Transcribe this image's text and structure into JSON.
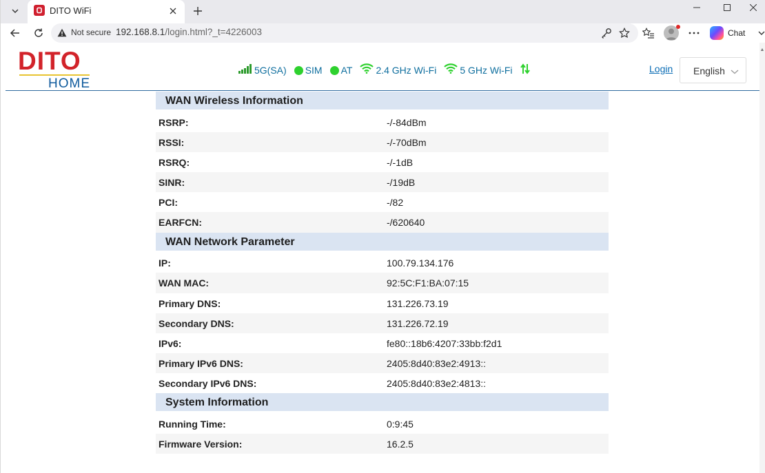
{
  "browser": {
    "tab_title": "DITO WiFi",
    "security_label": "Not secure",
    "url_host": "192.168.8.1",
    "url_path": "/login.html?_t=4226003",
    "chat_label": "Chat"
  },
  "header": {
    "logo_text": "DITO",
    "logo_subtext": "HOME",
    "status": {
      "network": "5G(SA)",
      "sim": "SIM",
      "at": "AT",
      "wifi_24": "2.4 GHz Wi-Fi",
      "wifi_5": "5 GHz Wi-Fi"
    },
    "login_label": "Login",
    "language": "English",
    "colors": {
      "status_dot": "#2ed12e",
      "wifi_icon": "#2ed12e",
      "link": "#0b6db5",
      "brand_red": "#d2232a",
      "brand_blue": "#0e5a9c"
    }
  },
  "sections": [
    {
      "title": "WAN Wireless Information",
      "rows": [
        {
          "label": "RSRP:",
          "value": "-/-84dBm"
        },
        {
          "label": "RSSI:",
          "value": "-/-70dBm"
        },
        {
          "label": "RSRQ:",
          "value": "-/-1dB"
        },
        {
          "label": "SINR:",
          "value": "-/19dB"
        },
        {
          "label": "PCI:",
          "value": "-/82"
        },
        {
          "label": "EARFCN:",
          "value": "-/620640"
        }
      ]
    },
    {
      "title": "WAN Network Parameter",
      "rows": [
        {
          "label": "IP:",
          "value": "100.79.134.176"
        },
        {
          "label": "WAN MAC:",
          "value": "92:5C:F1:BA:07:15"
        },
        {
          "label": "Primary DNS:",
          "value": "131.226.73.19"
        },
        {
          "label": "Secondary DNS:",
          "value": "131.226.72.19"
        },
        {
          "label": "IPv6:",
          "value": "fe80::18b6:4207:33bb:f2d1"
        },
        {
          "label": "Primary IPv6 DNS:",
          "value": "2405:8d40:83e2:4913::"
        },
        {
          "label": "Secondary IPv6 DNS:",
          "value": "2405:8d40:83e2:4813::"
        }
      ]
    },
    {
      "title": "System Information",
      "rows": [
        {
          "label": "Running Time:",
          "value": "0:9:45"
        },
        {
          "label": "Firmware Version:",
          "value": "16.2.5"
        }
      ]
    }
  ]
}
